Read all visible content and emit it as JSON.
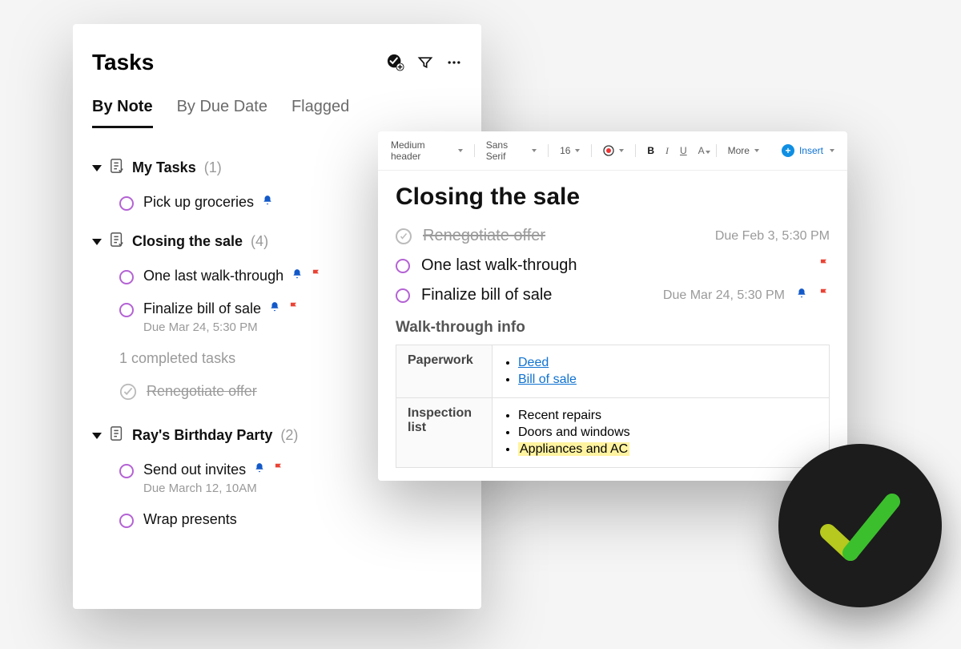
{
  "tasks_panel": {
    "title": "Tasks",
    "tabs": [
      "By Note",
      "By Due Date",
      "Flagged"
    ],
    "active_tab": 0,
    "groups": [
      {
        "name": "My Tasks",
        "count": 1,
        "items": [
          {
            "text": "Pick up groceries",
            "bell": true,
            "flag": false
          }
        ]
      },
      {
        "name": "Closing the sale",
        "count": 4,
        "items": [
          {
            "text": "One last walk-through",
            "bell": true,
            "flag": true
          },
          {
            "text": "Finalize bill of sale",
            "bell": true,
            "flag": true,
            "sub": "Due Mar 24, 5:30 PM"
          }
        ],
        "completed_count_label": "1 completed tasks",
        "completed": [
          {
            "text": "Renegotiate offer"
          }
        ]
      },
      {
        "name": "Ray's Birthday Party",
        "count": 2,
        "items": [
          {
            "text": "Send out invites",
            "bell": true,
            "flag": true,
            "sub": "Due March 12, 10AM"
          },
          {
            "text": "Wrap presents"
          }
        ]
      }
    ]
  },
  "note_panel": {
    "toolbar": {
      "style": "Medium header",
      "font": "Sans Serif",
      "size": "16",
      "more_label": "More",
      "insert_label": "Insert"
    },
    "title": "Closing the sale",
    "tasks": [
      {
        "text": "Renegotiate offer",
        "done": true,
        "due": "Due Feb 3, 5:30 PM"
      },
      {
        "text": "One last walk-through",
        "done": false,
        "flag": true
      },
      {
        "text": "Finalize bill of sale",
        "done": false,
        "due": "Due Mar 24, 5:30 PM",
        "bell": true,
        "flag": true
      }
    ],
    "section_title": "Walk-through info",
    "table": {
      "paperwork_label": "Paperwork",
      "paperwork_links": [
        "Deed",
        "Bill of sale"
      ],
      "inspection_label": "Inspection list",
      "inspection_items": [
        "Recent repairs",
        "Doors and windows",
        "Appliances and AC"
      ],
      "highlighted_index": 2
    }
  }
}
